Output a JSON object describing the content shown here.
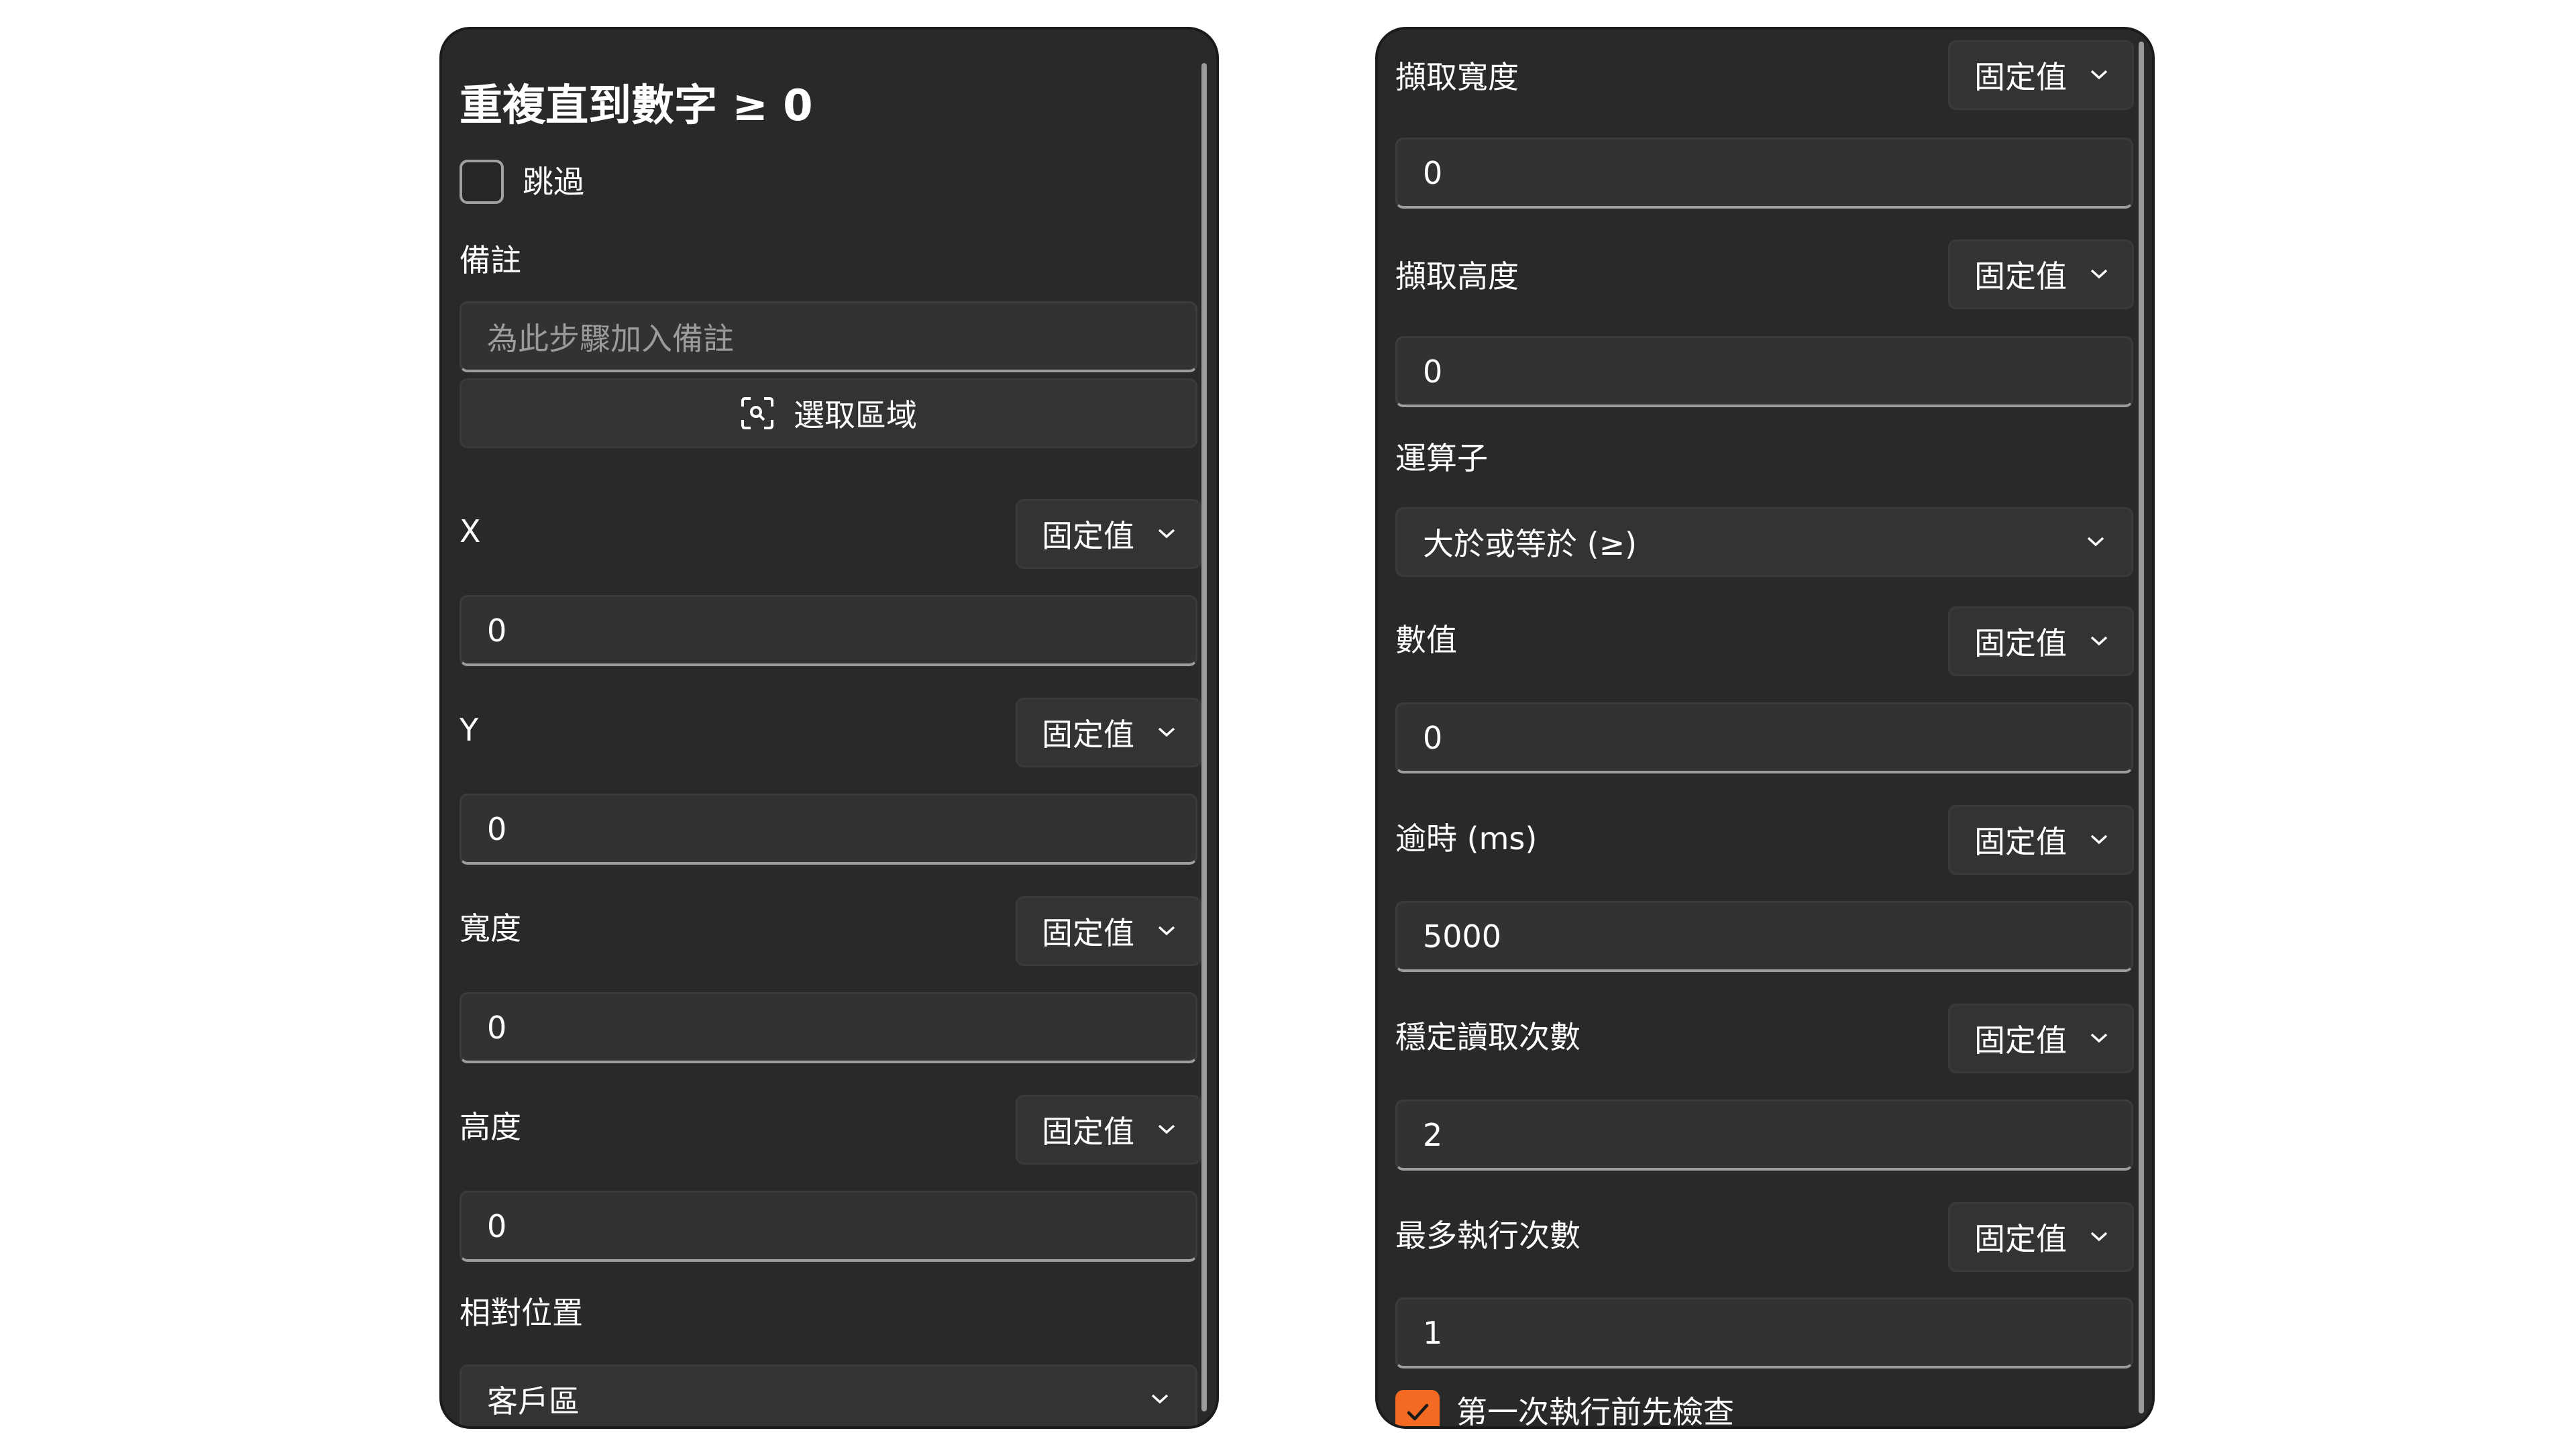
{
  "left_panel": {
    "title": "重複直到數字 ≥ 0",
    "skip_label": "跳過",
    "skip_checked": false,
    "note_label": "備註",
    "note_placeholder": "為此步驟加入備註",
    "select_region_label": "選取區域",
    "fields": [
      {
        "label": "X",
        "mode": "固定值",
        "value": "0"
      },
      {
        "label": "Y",
        "mode": "固定值",
        "value": "0"
      },
      {
        "label": "寬度",
        "mode": "固定值",
        "value": "0"
      },
      {
        "label": "高度",
        "mode": "固定值",
        "value": "0"
      }
    ],
    "relative_position_label": "相對位置",
    "relative_position_value": "客戶區"
  },
  "right_panel": {
    "fields_top": [
      {
        "label": "擷取寬度",
        "mode": "固定值",
        "value": "0"
      },
      {
        "label": "擷取高度",
        "mode": "固定值",
        "value": "0"
      }
    ],
    "operator_label": "運算子",
    "operator_value": "大於或等於 (≥)",
    "fields_bottom": [
      {
        "label": "數值",
        "mode": "固定值",
        "value": "0"
      },
      {
        "label": "逾時 (ms)",
        "mode": "固定值",
        "value": "5000"
      },
      {
        "label": "穩定讀取次數",
        "mode": "固定值",
        "value": "2"
      },
      {
        "label": "最多執行次數",
        "mode": "固定值",
        "value": "1"
      }
    ],
    "check_first_label": "第一次執行前先檢查",
    "check_first_checked": true
  },
  "colors": {
    "panel_bg": "#292929",
    "input_bg": "#323232",
    "accent": "#f46a23"
  }
}
